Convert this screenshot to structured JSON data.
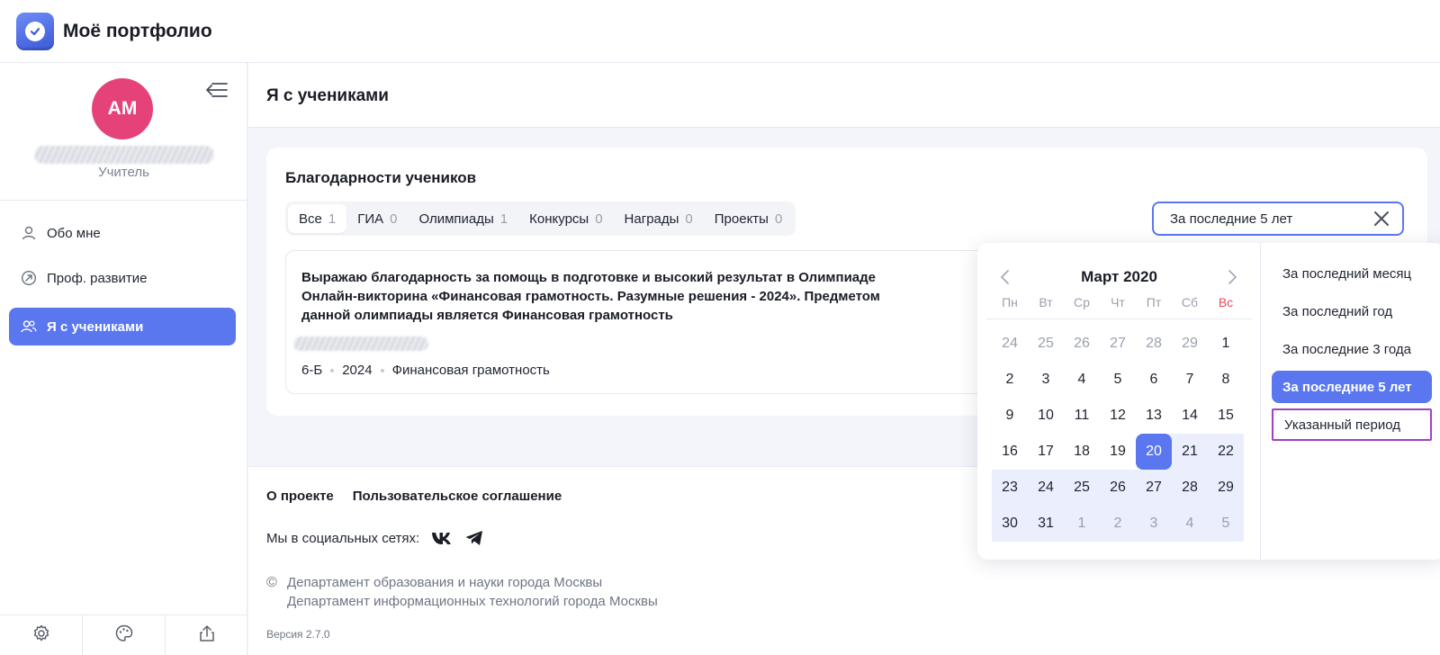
{
  "header": {
    "app_title": "Моё портфолио"
  },
  "sidebar": {
    "avatar_initials": "АМ",
    "role": "Учитель",
    "nav": [
      {
        "label": "Обо мне",
        "icon": "user-icon"
      },
      {
        "label": "Проф. развитие",
        "icon": "arrow-circle-icon"
      },
      {
        "label": "Я с учениками",
        "icon": "users-icon",
        "active": true
      }
    ],
    "bottom_icons": [
      "gear-icon",
      "palette-icon",
      "share-icon"
    ]
  },
  "page": {
    "title": "Я с учениками"
  },
  "card": {
    "title": "Благодарности учеников",
    "tabs": [
      {
        "label": "Все",
        "count": "1",
        "active": true
      },
      {
        "label": "ГИА",
        "count": "0"
      },
      {
        "label": "Олимпиады",
        "count": "1"
      },
      {
        "label": "Конкурсы",
        "count": "0"
      },
      {
        "label": "Награды",
        "count": "0"
      },
      {
        "label": "Проекты",
        "count": "0"
      }
    ],
    "filter_value": "За последние 5 лет",
    "item": {
      "text": "Выражаю благодарность за помощь в подготовке и высокий результат в Олимпиаде Онлайн-викторина «Финансовая грамотность. Разумные решения - 2024». Предметом данной олимпиады является Финансовая грамотность",
      "class": "6-Б",
      "year": "2024",
      "subject": "Финансовая грамотность"
    }
  },
  "footer": {
    "about": "О проекте",
    "agreement": "Пользовательское соглашение",
    "social_label": "Мы в социальных сетях:",
    "copyright_symbol": "©",
    "copyright_line1": "Департамент образования и науки города Москвы",
    "copyright_line2": "Департамент информационных технологий города Москвы",
    "version": "Версия 2.7.0"
  },
  "calendar": {
    "month_title": "Март 2020",
    "weekdays": [
      "Пн",
      "Вт",
      "Ср",
      "Чт",
      "Пт",
      "Сб",
      "Вс"
    ],
    "weeks": [
      [
        "24",
        "25",
        "26",
        "27",
        "28",
        "29",
        "1"
      ],
      [
        "2",
        "3",
        "4",
        "5",
        "6",
        "7",
        "8"
      ],
      [
        "9",
        "10",
        "11",
        "12",
        "13",
        "14",
        "15"
      ],
      [
        "16",
        "17",
        "18",
        "19",
        "20",
        "21",
        "22"
      ],
      [
        "23",
        "24",
        "25",
        "26",
        "27",
        "28",
        "29"
      ],
      [
        "30",
        "31",
        "1",
        "2",
        "3",
        "4",
        "5"
      ]
    ],
    "selected_day": "20",
    "accent_color": "#5a77f0",
    "sunday_color": "#e84a5f"
  },
  "presets": [
    {
      "label": "За последний месяц"
    },
    {
      "label": "За последний год"
    },
    {
      "label": "За последние 3 года"
    },
    {
      "label": "За последние 5 лет",
      "active": true
    },
    {
      "label": "Указанный период",
      "outlined": true
    }
  ]
}
